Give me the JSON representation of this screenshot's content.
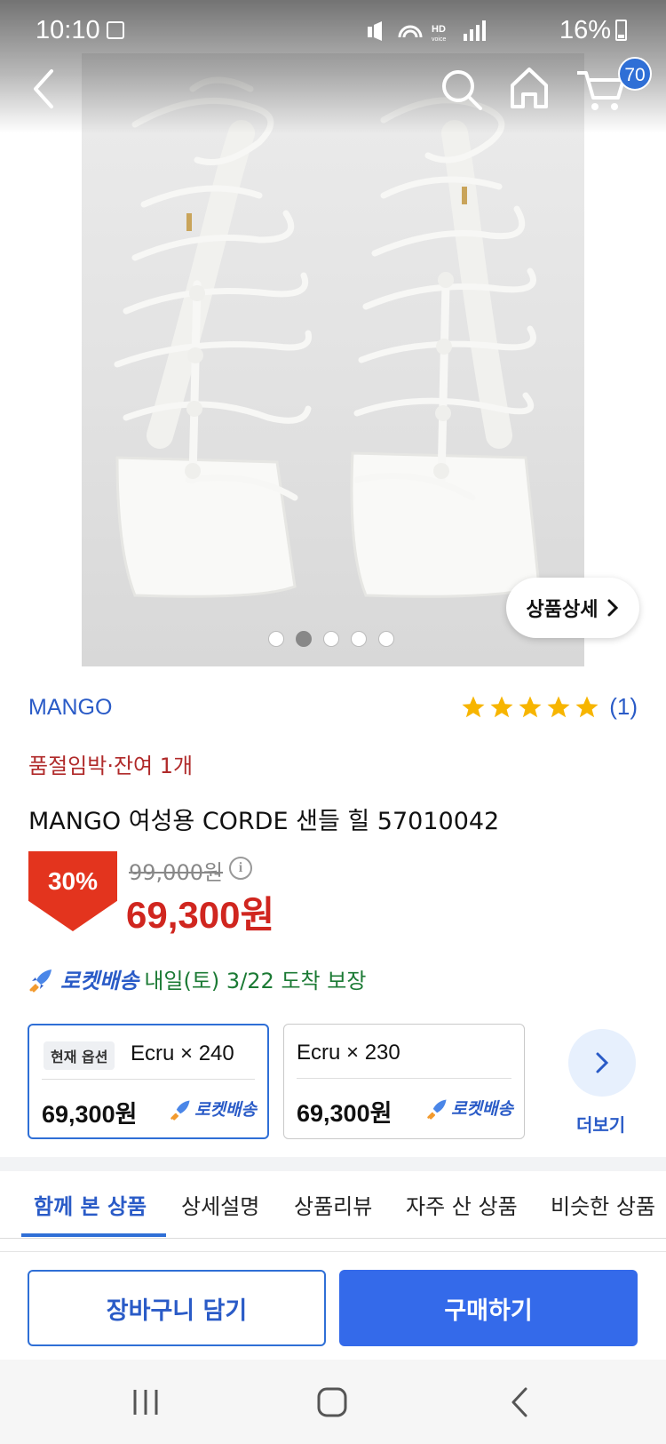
{
  "status_bar": {
    "time": "10:10",
    "battery": "16%"
  },
  "header": {
    "cart_count": "70"
  },
  "gallery": {
    "detail_label": "상품상세",
    "dot_count": 5,
    "active_index": 1
  },
  "product": {
    "brand": "MANGO",
    "rating": 5,
    "review_count": "(1)",
    "stock_notice": "품절임박·잔여 1개",
    "title": "MANGO 여성용 CORDE 샌들 힐 57010042",
    "discount": "30%",
    "original_price": "99,000원",
    "sale_price": "69,300원"
  },
  "delivery": {
    "label": "로켓배송",
    "eta": "내일(토) 3/22 도착 보장"
  },
  "options": {
    "current_tag": "현재 옵션",
    "items": [
      {
        "name": "Ecru × 240",
        "price": "69,300원",
        "shipping": "로켓배송"
      },
      {
        "name": "Ecru × 230",
        "price": "69,300원",
        "shipping": "로켓배송"
      }
    ],
    "more_label": "더보기"
  },
  "tabs": [
    "함께 본 상품",
    "상세설명",
    "상품리뷰",
    "자주 산 상품",
    "비슷한 상품"
  ],
  "actions": {
    "add_to_cart": "장바구니 담기",
    "buy_now": "구매하기"
  },
  "colors": {
    "accent_blue": "#2f6fd6",
    "sale_red": "#d0261f",
    "badge_red": "#e3341e",
    "delivery_green": "#1b7a34",
    "star_gold": "#f7b500"
  }
}
